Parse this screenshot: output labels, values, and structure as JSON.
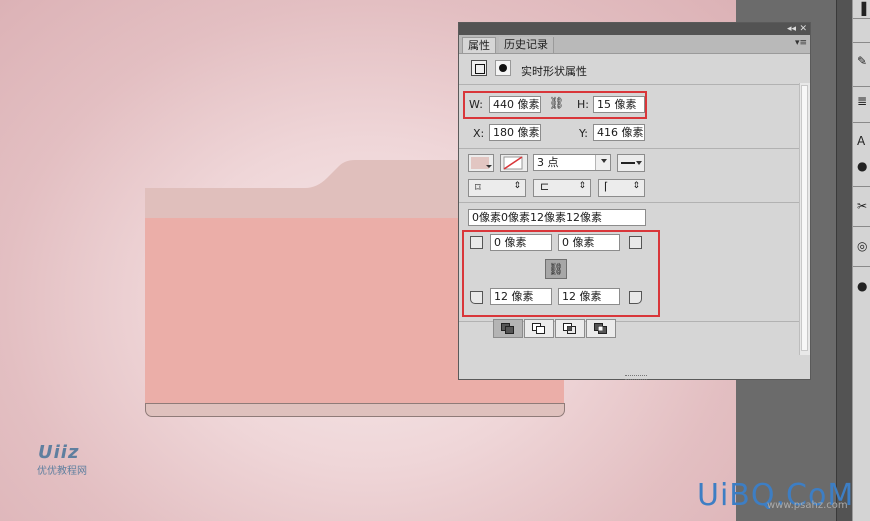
{
  "panel": {
    "tabs": [
      "属性",
      "历史记录"
    ],
    "heading": "实时形状属性",
    "size": {
      "w_label": "W:",
      "w_value": "440 像素",
      "h_label": "H:",
      "h_value": "15 像素"
    },
    "position": {
      "x_label": "X:",
      "x_value": "180 像素",
      "y_label": "Y:",
      "y_value": "416 像素"
    },
    "stroke_width": "3 点",
    "radii_summary": "0像素0像素12像素12像素",
    "corners": {
      "top_left": "0 像素",
      "top_right": "0 像素",
      "bottom_left": "12 像素",
      "bottom_right": "12 像素"
    }
  },
  "watermarks": {
    "left_logo": "Uiiz",
    "left_caption": "优优教程网",
    "right_logo": "UiBQ.CoM",
    "right_caption": "www.psahz.com"
  },
  "colors": {
    "fill_swatch": "#e2c6c2",
    "highlight": "#d9363a",
    "folder_front": "#ebaea8",
    "folder_back": "#e0bfbc"
  }
}
